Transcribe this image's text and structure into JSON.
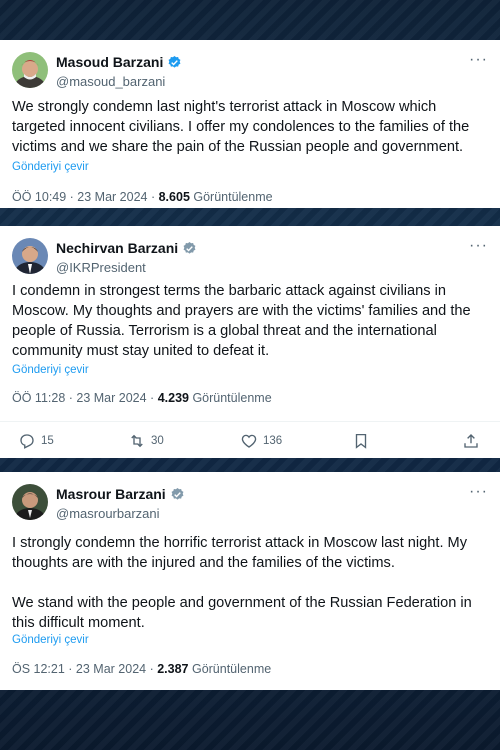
{
  "tweets": [
    {
      "name": "Masoud Barzani",
      "handle": "@masoud_barzani",
      "text": "We strongly condemn last night's terrorist attack in Moscow which targeted innocent civilians. I offer my condolences to the families of the victims and we share the pain of the Russian people and government.",
      "translate": "Gönderiyi çevir",
      "time_date": "ÖÖ 10:49 · 23 Mar 2024 · ",
      "views": "8.605",
      "views_label": " Görüntülenme"
    },
    {
      "name": "Nechirvan Barzani",
      "handle": "@IKRPresident",
      "text": "I condemn in strongest terms the barbaric attack against civilians in Moscow. My thoughts and prayers are with the victims' families and the people of Russia. Terrorism is a global threat and the international community must stay united to defeat it.",
      "translate": "Gönderiyi çevir",
      "time_date": "ÖÖ 11:28 · 23 Mar 2024 · ",
      "views": "4.239",
      "views_label": " Görüntülenme",
      "actions": {
        "replies": "15",
        "reposts": "30",
        "likes": "136"
      }
    },
    {
      "name": "Masrour Barzani",
      "handle": "@masrourbarzani",
      "text": "I strongly condemn the horrific terrorist attack in Moscow last night. My thoughts are with the injured and the families of the victims.\n\nWe stand with the people and government of the Russian Federation in this difficult moment.",
      "translate": "Gönderiyi çevir",
      "time_date": "ÖS 12:21 · 23 Mar 2024 · ",
      "views": "2.387",
      "views_label": " Görüntülenme"
    }
  ],
  "more_label": "···",
  "icons": {
    "verified": "verified-badge-icon",
    "reply": "reply-icon",
    "repost": "repost-icon",
    "like": "heart-icon",
    "bookmark": "bookmark-icon",
    "share": "share-icon"
  },
  "colors": {
    "verified": "#1d9bf0",
    "link": "#1d9bf0",
    "muted": "#536471",
    "text": "#0f1419"
  }
}
